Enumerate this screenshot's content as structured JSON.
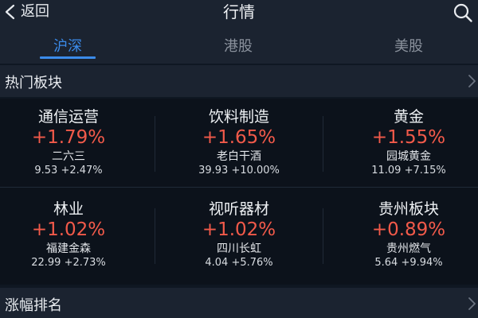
{
  "header": {
    "back_label": "返回",
    "title": "行情",
    "back_icon": "chevron-left-icon",
    "search_icon": "search-icon"
  },
  "tabs": [
    {
      "label": "沪深",
      "active": true
    },
    {
      "label": "港股",
      "active": false
    },
    {
      "label": "美股",
      "active": false
    }
  ],
  "sections": {
    "hot": {
      "label": "热门板块"
    },
    "rank": {
      "label": "涨幅排名"
    }
  },
  "sectors": [
    {
      "name": "通信运营",
      "change": "+1.79%",
      "stock": "二六三",
      "price": "9.53",
      "stock_change": "+2.47%"
    },
    {
      "name": "饮料制造",
      "change": "+1.65%",
      "stock": "老白干酒",
      "price": "39.93",
      "stock_change": "+10.00%"
    },
    {
      "name": "黄金",
      "change": "+1.55%",
      "stock": "园城黄金",
      "price": "11.09",
      "stock_change": "+7.15%"
    },
    {
      "name": "林业",
      "change": "+1.02%",
      "stock": "福建金森",
      "price": "22.99",
      "stock_change": "+2.73%"
    },
    {
      "name": "视听器材",
      "change": "+1.02%",
      "stock": "四川长虹",
      "price": "4.04",
      "stock_change": "+5.76%"
    },
    {
      "name": "贵州板块",
      "change": "+0.89%",
      "stock": "贵州燃气",
      "price": "5.64",
      "stock_change": "+9.94%"
    }
  ],
  "colors": {
    "up": "#f25a4a",
    "accent": "#3b8bea",
    "background": "#0f1722",
    "panel": "#1b2330"
  }
}
